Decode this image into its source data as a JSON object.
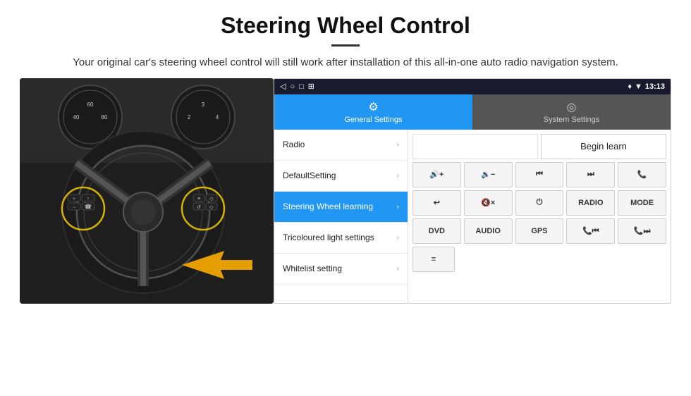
{
  "header": {
    "title": "Steering Wheel Control",
    "subtitle": "Your original car's steering wheel control will still work after installation of this all-in-one auto radio navigation system.",
    "divider": true
  },
  "status_bar": {
    "time": "13:13",
    "icons": [
      "◁",
      "○",
      "□",
      "⊞",
      "♥",
      "▼"
    ]
  },
  "nav_bar": {
    "icons": [
      "◁",
      "○",
      "□"
    ]
  },
  "tabs": [
    {
      "id": "general",
      "label": "General Settings",
      "icon": "⚙",
      "active": true
    },
    {
      "id": "system",
      "label": "System Settings",
      "icon": "◎",
      "active": false
    }
  ],
  "menu_items": [
    {
      "id": "radio",
      "label": "Radio",
      "active": false
    },
    {
      "id": "default",
      "label": "DefaultSetting",
      "active": false
    },
    {
      "id": "steering",
      "label": "Steering Wheel learning",
      "active": true
    },
    {
      "id": "tricoloured",
      "label": "Tricoloured light settings",
      "active": false
    },
    {
      "id": "whitelist",
      "label": "Whitelist setting",
      "active": false
    }
  ],
  "panel": {
    "begin_learn_label": "Begin learn",
    "button_rows": [
      [
        {
          "id": "vol_up",
          "label": "🔊+",
          "type": "icon"
        },
        {
          "id": "vol_down",
          "label": "🔉−",
          "type": "icon"
        },
        {
          "id": "prev_track",
          "label": "⏮",
          "type": "icon"
        },
        {
          "id": "next_track",
          "label": "⏭",
          "type": "icon"
        },
        {
          "id": "call",
          "label": "📞",
          "type": "icon"
        }
      ],
      [
        {
          "id": "end_call",
          "label": "↩",
          "type": "icon"
        },
        {
          "id": "mute",
          "label": "🔇×",
          "type": "icon"
        },
        {
          "id": "power",
          "label": "⏻",
          "type": "icon"
        },
        {
          "id": "radio_btn",
          "label": "RADIO",
          "type": "text"
        },
        {
          "id": "mode_btn",
          "label": "MODE",
          "type": "text"
        }
      ],
      [
        {
          "id": "dvd_btn",
          "label": "DVD",
          "type": "text"
        },
        {
          "id": "audio_btn",
          "label": "AUDIO",
          "type": "text"
        },
        {
          "id": "gps_btn",
          "label": "GPS",
          "type": "text"
        },
        {
          "id": "tel_prev",
          "label": "📞⏮",
          "type": "icon"
        },
        {
          "id": "tel_next",
          "label": "📞⏭",
          "type": "icon"
        }
      ]
    ]
  }
}
